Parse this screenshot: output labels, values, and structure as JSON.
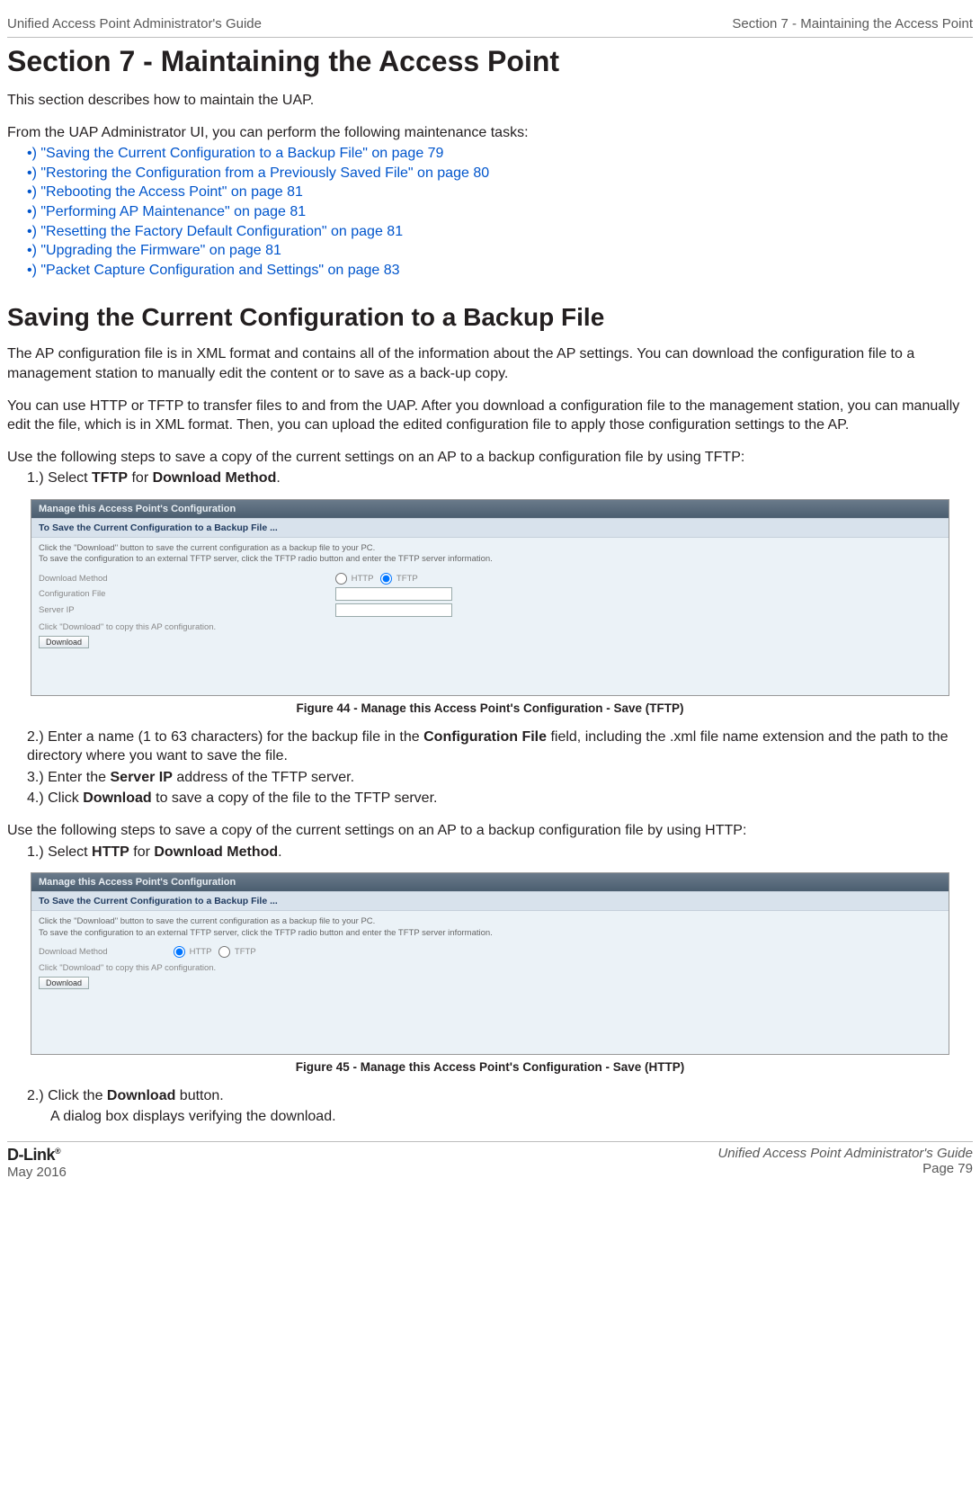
{
  "header": {
    "left": "Unified Access Point Administrator's Guide",
    "right": "Section 7 - Maintaining the Access Point"
  },
  "section_title": "Section 7 - Maintaining the Access Point",
  "intro_1": "This section describes how to maintain the UAP.",
  "intro_2": "From the UAP Administrator UI, you can perform the following maintenance tasks:",
  "links": [
    "\"Saving the Current Configuration to a Backup File\" on page 79",
    "\"Restoring the Configuration from a Previously Saved File\" on page 80",
    "\"Rebooting the Access Point\" on page 81",
    "\"Performing AP Maintenance\" on page 81",
    "\"Resetting the Factory Default Configuration\" on page 81",
    "\"Upgrading the Firmware\" on page 81",
    "\"Packet Capture Configuration and Settings\" on page 83"
  ],
  "subsection_title": "Saving the Current Configuration to a Backup File",
  "para1": "The AP configuration file is in XML format and contains all of the information about the AP settings. You can download the configuration file to a management station to manually edit the content or to save as a back-up copy.",
  "para2": "You can use HTTP or TFTP to transfer files to and from the UAP. After you download a configuration file to the management station, you can manually edit the file, which is in XML format. Then, you can upload the edited configuration file to apply those configuration settings to the AP.",
  "para3": "Use the following steps to save a copy of the current settings on an AP to a backup configuration file by using TFTP:",
  "tftp_step1_pre": "1.)  Select ",
  "tftp_step1_b1": "TFTP",
  "tftp_step1_mid": " for ",
  "tftp_step1_b2": "Download Method",
  "tftp_step1_end": ".",
  "panel1": {
    "title": "Manage this Access Point's Configuration",
    "sub": "To Save the Current Configuration to a Backup File ...",
    "hint1": "Click the \"Download\" button to save the current configuration as a backup file to your PC.",
    "hint2": "To save the configuration to an external TFTP server, click the TFTP radio button and enter the TFTP server information.",
    "row_dm": "Download Method",
    "row_http": "HTTP",
    "row_tftp": "TFTP",
    "row_cf": "Configuration File",
    "row_ip": "Server IP",
    "dl_note": "Click \"Download\" to copy this AP configuration.",
    "dl_btn": "Download"
  },
  "fig44": "Figure 44 - Manage this Access Point's Configuration - Save (TFTP)",
  "tftp_step2_pre": "2.)  Enter a name (1 to 63 characters) for the backup file in the ",
  "tftp_step2_b": "Configuration File",
  "tftp_step2_post": " field, including the .xml file name extension and the path to the directory where you want to save the file.",
  "tftp_step3_pre": "3.)  Enter the ",
  "tftp_step3_b": "Server IP",
  "tftp_step3_post": " address of the TFTP server.",
  "tftp_step4_pre": "4.)  Click ",
  "tftp_step4_b": "Download",
  "tftp_step4_post": " to save a copy of the file to the TFTP server.",
  "para4": "Use the following steps to save a copy of the current settings on an AP to a backup configuration file by using HTTP:",
  "http_step1_pre": "1.)  Select ",
  "http_step1_b1": "HTTP",
  "http_step1_mid": " for ",
  "http_step1_b2": "Download Method",
  "http_step1_end": ".",
  "panel2": {
    "title": "Manage this Access Point's Configuration",
    "sub": "To Save the Current Configuration to a Backup File ...",
    "hint1": "Click the \"Download\" button to save the current configuration as a backup file to your PC.",
    "hint2": "To save the configuration to an external TFTP server, click the TFTP radio button and enter the TFTP server information.",
    "row_dm": "Download Method",
    "row_http": "HTTP",
    "row_tftp": "TFTP",
    "dl_note": "Click \"Download\" to copy this AP configuration.",
    "dl_btn": "Download"
  },
  "fig45": "Figure 45 - Manage this Access Point's Configuration - Save (HTTP)",
  "http_step2_pre": "2.)  Click the ",
  "http_step2_b": "Download",
  "http_step2_post": " button.",
  "http_step2_line2": "A dialog box displays verifying the download.",
  "footer": {
    "brand": "D-Link",
    "date": "May 2016",
    "right1": "Unified Access Point Administrator's Guide",
    "right2": "Page 79"
  }
}
